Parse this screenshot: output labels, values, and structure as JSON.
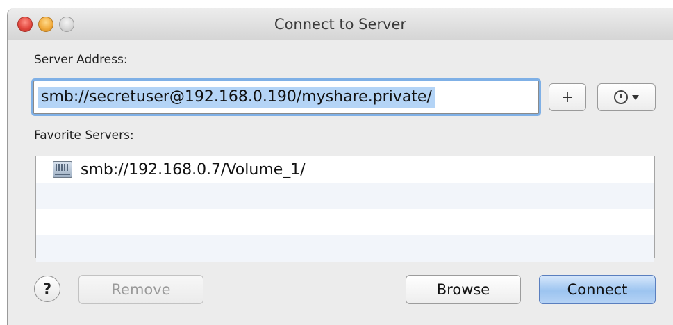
{
  "window": {
    "title": "Connect to Server"
  },
  "server_address": {
    "label": "Server Address:",
    "value": "smb://secretuser@192.168.0.190/myshare.private/"
  },
  "toolbar": {
    "add_label": "+",
    "recent_icon": "clock-icon"
  },
  "favorites": {
    "label": "Favorite Servers:",
    "items": [
      {
        "text": "smb://192.168.0.7/Volume_1/",
        "icon": "server-icon"
      }
    ]
  },
  "buttons": {
    "help_label": "?",
    "remove_label": "Remove",
    "browse_label": "Browse",
    "connect_label": "Connect"
  },
  "colors": {
    "selection": "#b4d4f6",
    "focus_ring": "#7fb0e6",
    "default_button": "#9cc4f0",
    "close": "#e0443b",
    "minimize": "#f0a93a"
  }
}
